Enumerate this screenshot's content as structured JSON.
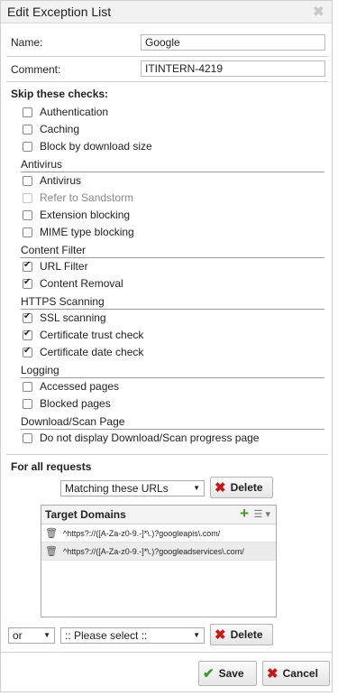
{
  "dialog": {
    "title": "Edit Exception List"
  },
  "form": {
    "name_label": "Name:",
    "name_value": "Google",
    "comment_label": "Comment:",
    "comment_value": "ITINTERN-4219"
  },
  "skip_heading": "Skip these checks:",
  "general": [
    {
      "label": "Authentication",
      "checked": false,
      "disabled": false
    },
    {
      "label": "Caching",
      "checked": false,
      "disabled": false
    },
    {
      "label": "Block by download size",
      "checked": false,
      "disabled": false
    }
  ],
  "sections": [
    {
      "title": "Antivirus",
      "items": [
        {
          "label": "Antivirus",
          "checked": false,
          "disabled": false
        },
        {
          "label": "Refer to Sandstorm",
          "checked": false,
          "disabled": true
        },
        {
          "label": "Extension blocking",
          "checked": false,
          "disabled": false
        },
        {
          "label": "MIME type blocking",
          "checked": false,
          "disabled": false
        }
      ]
    },
    {
      "title": "Content Filter",
      "items": [
        {
          "label": "URL Filter",
          "checked": true,
          "disabled": false
        },
        {
          "label": "Content Removal",
          "checked": true,
          "disabled": false
        }
      ]
    },
    {
      "title": "HTTPS Scanning",
      "items": [
        {
          "label": "SSL scanning",
          "checked": true,
          "disabled": false
        },
        {
          "label": "Certificate trust check",
          "checked": true,
          "disabled": false
        },
        {
          "label": "Certificate date check",
          "checked": true,
          "disabled": false
        }
      ]
    },
    {
      "title": "Logging",
      "items": [
        {
          "label": "Accessed pages",
          "checked": false,
          "disabled": false
        },
        {
          "label": "Blocked pages",
          "checked": false,
          "disabled": false
        }
      ]
    },
    {
      "title": "Download/Scan Page",
      "items": [
        {
          "label": "Do not display Download/Scan progress page",
          "checked": false,
          "disabled": false
        }
      ]
    }
  ],
  "requests": {
    "heading": "For all requests",
    "match_select": "Matching these URLs",
    "delete_label": "Delete",
    "panel_title": "Target Domains",
    "domains": [
      "^https?://([A-Za-z0-9.-]*\\.)?googleapis\\.com/",
      "^https?://([A-Za-z0-9.-]*\\.)?googleadservices\\.com/"
    ],
    "or_select": "or",
    "please_select": ":: Please select ::",
    "delete2_label": "Delete"
  },
  "footer": {
    "save_label": "Save",
    "cancel_label": "Cancel"
  },
  "icons": {
    "close": "close-icon",
    "delete": "red-x-icon",
    "save": "green-check-icon",
    "cancel": "red-x-icon",
    "add": "plus-icon",
    "trash": "trash-icon"
  }
}
